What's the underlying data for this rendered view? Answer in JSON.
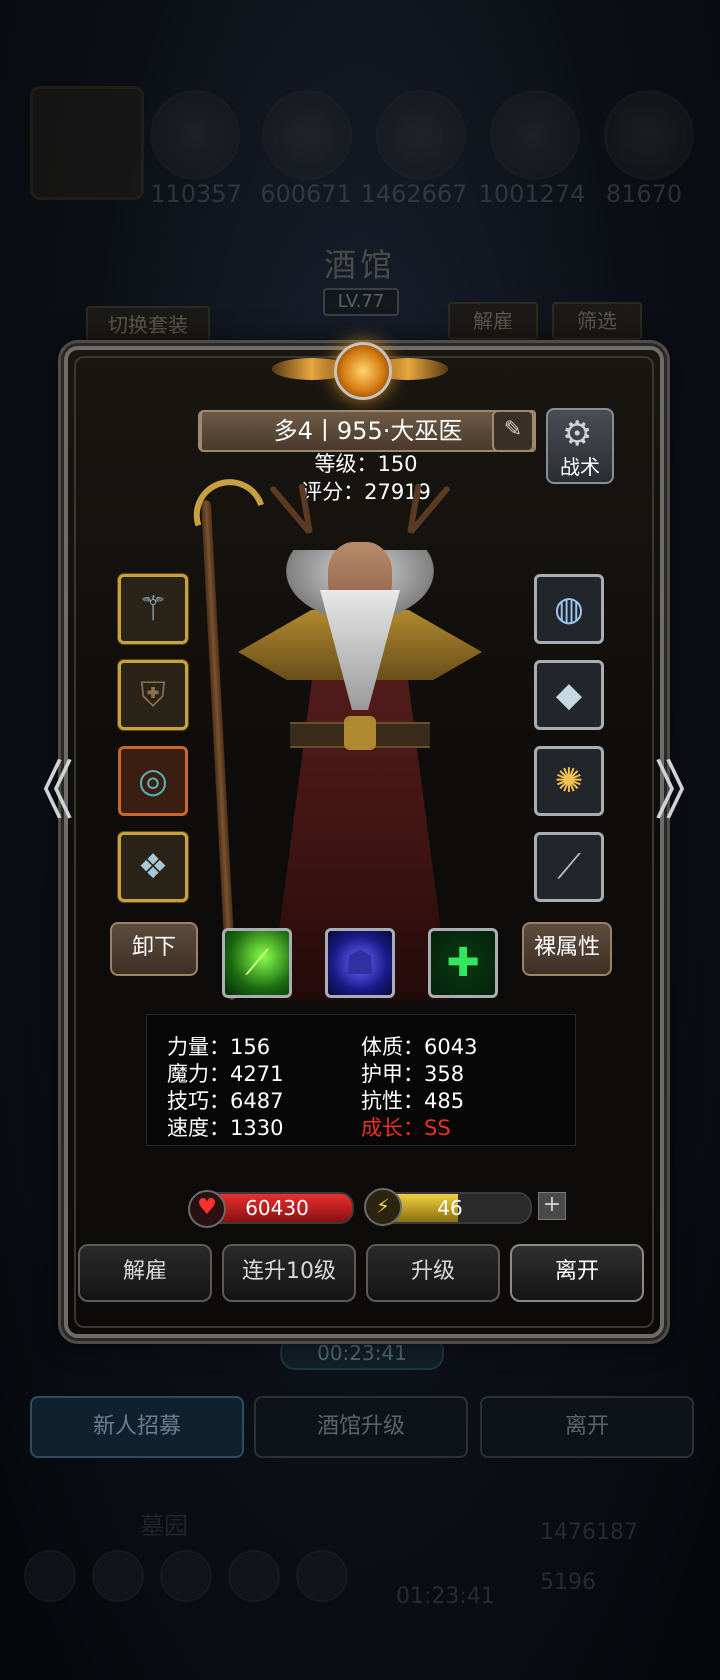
{
  "background": {
    "resources": [
      "110357",
      "600671",
      "1462667",
      "1001274",
      "81670"
    ],
    "tavern_title": "酒馆",
    "tavern_level": "LV.77",
    "switch_set_label": "切换套装",
    "dismiss_label": "解雇",
    "filter_label": "筛选",
    "timer": "00:23:41",
    "bottom_buttons": [
      "新人招募",
      "酒馆升级",
      "离开"
    ],
    "footer_label": "墓园",
    "footer_timer": "01:23:41",
    "footer_value_1": "1476187",
    "footer_value_2": "5196"
  },
  "hero": {
    "name": "多4丨955·大巫医",
    "level_line": "等级：150",
    "score_line": "评分：27919",
    "tactics_label": "战术",
    "unequip_label": "卸下",
    "bare_attr_label": "裸属性"
  },
  "stats": {
    "strength": "力量：156",
    "magic": "魔力：4271",
    "skill": "技巧：6487",
    "speed": "速度：1330",
    "constitution": "体质：6043",
    "armor": "护甲：358",
    "resistance": "抗性：485",
    "growth": "成长：SS"
  },
  "bars": {
    "hp": "60430",
    "energy": "46",
    "energy_fill_fraction": 0.55
  },
  "actions": {
    "dismiss": "解雇",
    "level_up_10": "连升10级",
    "level_up": "升级",
    "leave": "离开"
  },
  "icons": {
    "left_slots": [
      "staff-icon",
      "armor-icon",
      "ring-icon",
      "amulet-icon"
    ],
    "right_slots": [
      "orb-icon",
      "gem-stone-icon",
      "lantern-icon",
      "bracer-icon"
    ],
    "skills": [
      "green-slash-icon",
      "blue-shade-icon",
      "green-cross-icon"
    ]
  },
  "colors": {
    "growth": "#e8321e",
    "hp": "#e83030",
    "energy": "#f0d040"
  }
}
